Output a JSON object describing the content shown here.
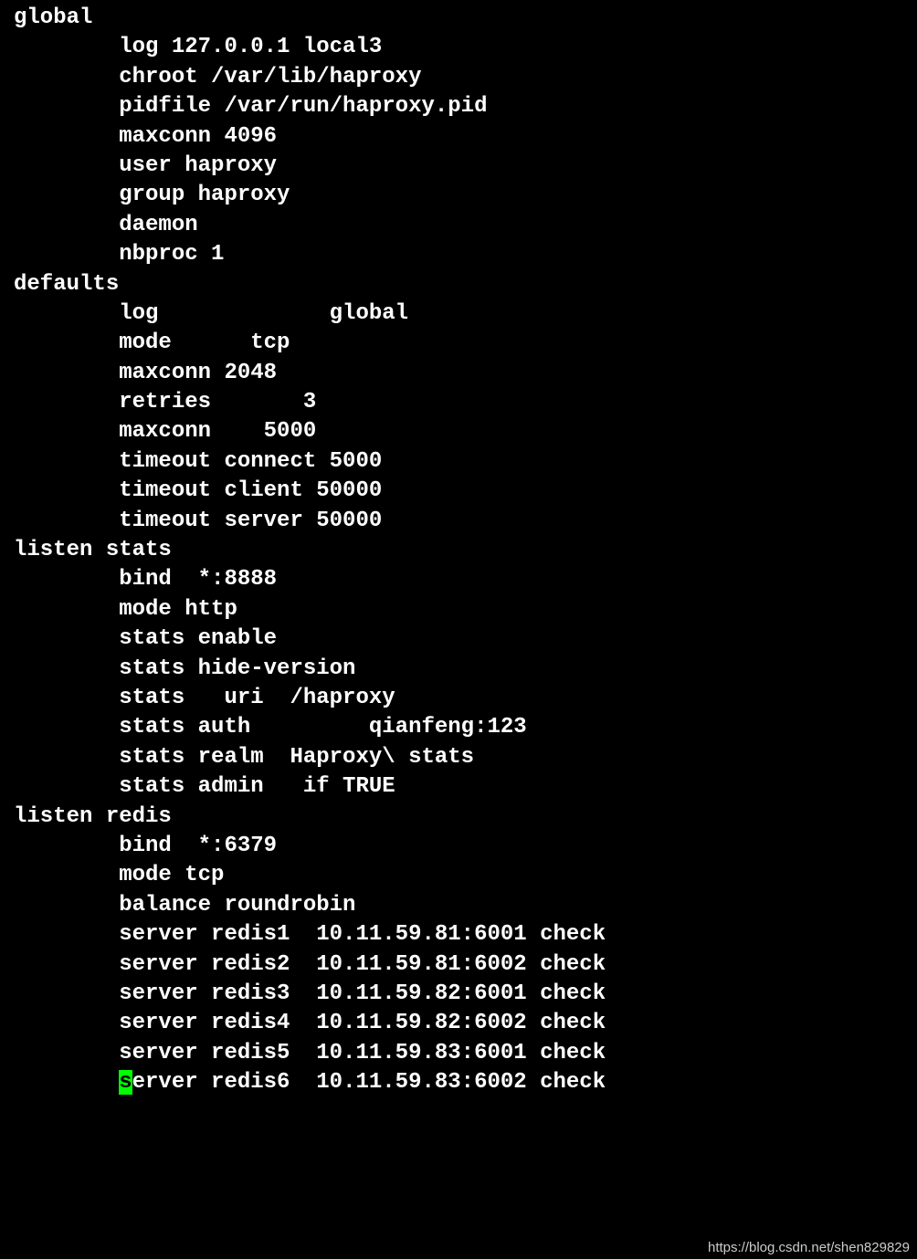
{
  "lines": [
    "global",
    "        log 127.0.0.1 local3",
    "        chroot /var/lib/haproxy",
    "        pidfile /var/run/haproxy.pid",
    "        maxconn 4096",
    "        user haproxy",
    "        group haproxy",
    "        daemon",
    "        nbproc 1",
    "defaults",
    "        log             global",
    "        mode      tcp",
    "        maxconn 2048",
    "        retries       3",
    "        maxconn    5000",
    "        timeout connect 5000",
    "        timeout client 50000",
    "        timeout server 50000",
    "listen stats",
    "        bind  *:8888",
    "        mode http",
    "        stats enable",
    "        stats hide-version",
    "        stats   uri  /haproxy",
    "        stats auth         qianfeng:123",
    "        stats realm  Haproxy\\ stats",
    "        stats admin   if TRUE",
    "",
    "listen redis",
    "        bind  *:6379",
    "        mode tcp",
    "        balance roundrobin",
    "",
    "",
    "",
    "",
    "        server redis1  10.11.59.81:6001 check",
    "        server redis2  10.11.59.81:6002 check",
    "        server redis3  10.11.59.82:6001 check",
    "        server redis4  10.11.59.82:6002 check",
    "        server redis5  10.11.59.83:6001 check"
  ],
  "lastLinePrefix": "        ",
  "lastLineCursorChar": "s",
  "lastLineSuffix": "erver redis6  10.11.59.83:6002 check",
  "watermark": "https://blog.csdn.net/shen829829"
}
